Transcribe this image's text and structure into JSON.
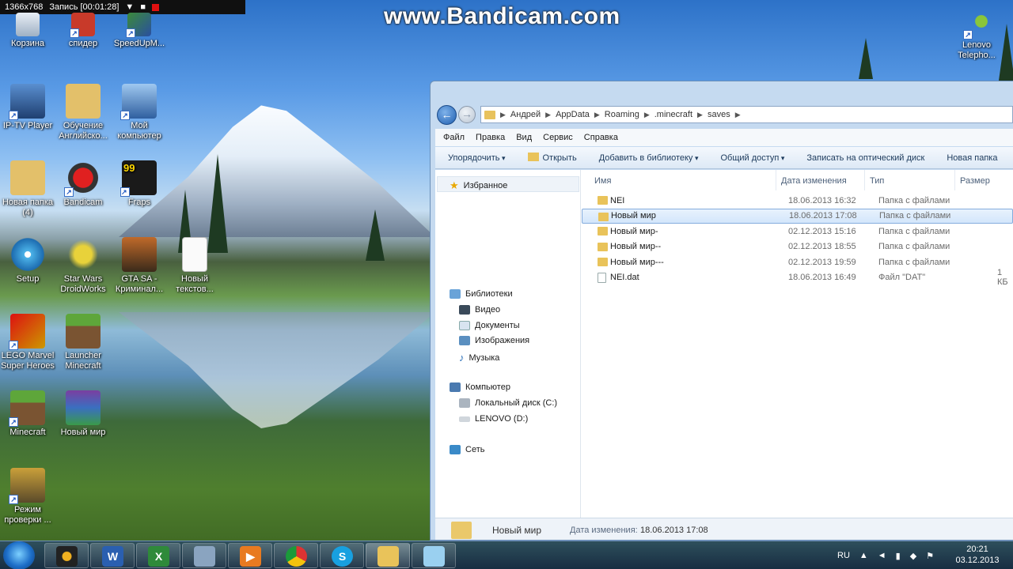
{
  "recording": {
    "resolution": "1366x768",
    "status": "Запись [00:01:28]"
  },
  "watermark": "www.Bandicam.com",
  "desktop_icons": [
    "Корзина",
    "спидер",
    "SpeedUpM...",
    "IP-TV Player",
    "Обучение Английско...",
    "Мой компьютер",
    "Новая папка (4)",
    "Bandicam",
    "Fraps",
    "Setup",
    "Star Wars DroidWorks",
    "GTA SA - Криминал...",
    "Новый текстов...",
    "LEGO Marvel Super Heroes",
    "Launcher Minecraft",
    "Minecraft",
    "Новый мир",
    "Режим проверки ...",
    "Lenovo Telepho..."
  ],
  "explorer": {
    "breadcrumb": [
      "Андрей",
      "AppData",
      "Roaming",
      ".minecraft",
      "saves"
    ],
    "menu": [
      "Файл",
      "Правка",
      "Вид",
      "Сервис",
      "Справка"
    ],
    "toolbar": [
      "Упорядочить",
      "Открыть",
      "Добавить в библиотеку",
      "Общий доступ",
      "Записать на оптический диск",
      "Новая папка"
    ],
    "nav": {
      "favorites": "Избранное",
      "libraries": "Библиотеки",
      "lib_items": [
        "Видео",
        "Документы",
        "Изображения",
        "Музыка"
      ],
      "computer": "Компьютер",
      "drives": [
        "Локальный диск (C:)",
        "LENOVO (D:)"
      ],
      "network": "Сеть"
    },
    "columns": [
      "Имя",
      "Дата изменения",
      "Тип",
      "Размер"
    ],
    "files": [
      {
        "name": "NEI",
        "date": "18.06.2013 16:32",
        "type": "Папка с файлами",
        "size": ""
      },
      {
        "name": "Новый мир",
        "date": "18.06.2013 17:08",
        "type": "Папка с файлами",
        "size": ""
      },
      {
        "name": "Новый мир-",
        "date": "02.12.2013 15:16",
        "type": "Папка с файлами",
        "size": ""
      },
      {
        "name": "Новый мир--",
        "date": "02.12.2013 18:55",
        "type": "Папка с файлами",
        "size": ""
      },
      {
        "name": "Новый мир---",
        "date": "02.12.2013 19:59",
        "type": "Папка с файлами",
        "size": ""
      },
      {
        "name": "NEI.dat",
        "date": "18.06.2013 16:49",
        "type": "Файл \"DAT\"",
        "size": "1 КБ"
      }
    ],
    "status": {
      "name": "Новый мир",
      "label": "Дата изменения:",
      "value": "18.06.2013 17:08"
    }
  },
  "taskbar": {
    "lang": "RU",
    "time": "20:21",
    "date": "03.12.2013"
  },
  "colors": {
    "accent": "#1f5fb0",
    "selection": "#d3e6fb",
    "folder": "#e9c35a"
  }
}
